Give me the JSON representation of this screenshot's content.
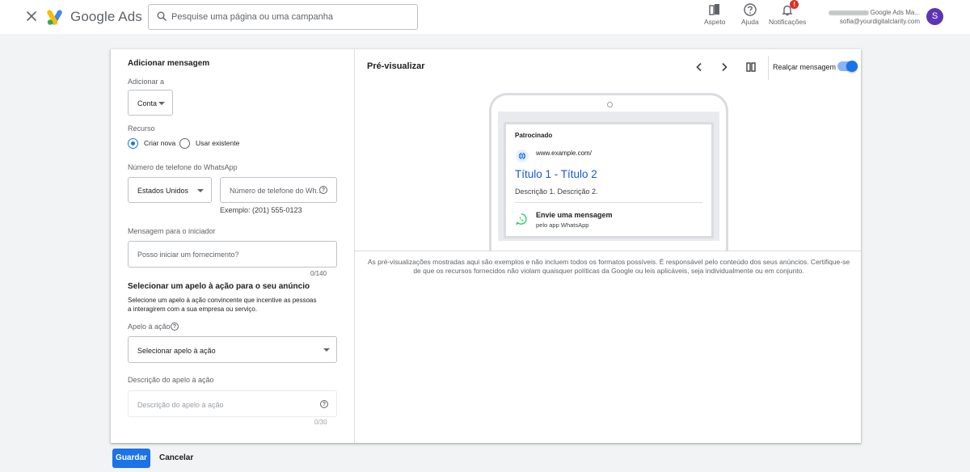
{
  "header": {
    "app_name": "Google Ads",
    "search_placeholder": "Pesquise uma página ou uma campanha",
    "tools": {
      "appearance": "Aspeto",
      "help": "Ajuda",
      "notifications": "Notificações",
      "notification_badge": "!"
    },
    "account": {
      "name": "Google Ads Ma...",
      "email": "sofia@yourdigitalclarity.com",
      "avatar_letter": "S"
    }
  },
  "form": {
    "title": "Adicionar mensagem",
    "add_to_label": "Adicionar a",
    "add_to_value": "Conta",
    "resource_label": "Recurso",
    "radio_create": "Criar nova",
    "radio_existing": "Usar existente",
    "whatsapp_label": "Número de telefone do WhatsApp",
    "country_value": "Estados Unidos",
    "phone_placeholder": "Número de telefone do Wh...",
    "phone_example": "Exemplo: (201) 555-0123",
    "starter_label": "Mensagem para o iniciador",
    "starter_placeholder": "Posso iniciar um fornecimento?",
    "starter_counter": "0/140",
    "cta_section_title": "Selecionar um apelo à ação para o seu anúncio",
    "cta_section_desc_1": "Selecione um apelo à ação convincente que incentive as pessoas",
    "cta_section_desc_2": "a interagirem com a sua empresa ou serviço.",
    "cta_label": "Apelo à ação",
    "cta_value": "Selecionar apelo à ação",
    "cta_desc_label": "Descrição do apelo à ação",
    "cta_desc_placeholder": "Descrição do apelo à ação",
    "cta_desc_counter": "0/30"
  },
  "preview": {
    "title": "Pré-visualizar",
    "highlight_label": "Realçar mensagem",
    "highlight_on": true,
    "ad": {
      "sponsored": "Patrocinado",
      "url": "www.example.com/",
      "headline": "Título 1 - Título 2",
      "description": "Descrição 1. Descrição 2.",
      "message_title": "Envie uma mensagem",
      "message_sub": "pelo app WhatsApp"
    },
    "disclaimer": "As pré-visualizações mostradas aqui são exemplos e não incluem todos os formatos possíveis. É responsável pelo conteúdo dos seus anúncios. Certifique-se de que os recursos fornecidos não violam quaisquer políticas da Google ou leis aplicáveis, seja individualmente ou em conjunto."
  },
  "footer": {
    "save": "Guardar",
    "cancel": "Cancelar"
  },
  "colors": {
    "accent": "#1a73e8",
    "whatsapp": "#25d366",
    "avatar": "#5e35b1",
    "badge": "#d93025"
  }
}
